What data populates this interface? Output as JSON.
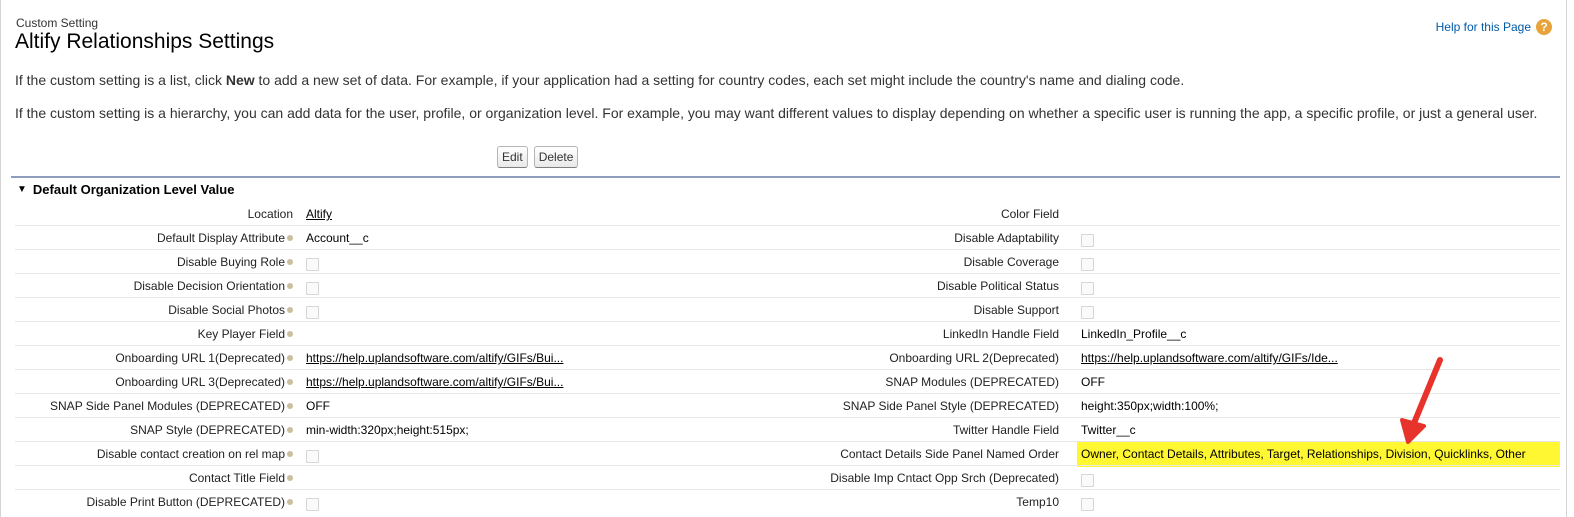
{
  "page": {
    "breadcrumb": "Custom Setting",
    "title": "Altify Relationships Settings",
    "help_link": "Help for this Page",
    "help_icon": "question-mark-icon",
    "para1_prefix": "If the custom setting is a list, click ",
    "para1_bold": "New",
    "para1_suffix": " to add a new set of data. For example, if your application had a setting for country codes, each set might include the country's name and dialing code.",
    "para2": "If the custom setting is a hierarchy, you can add data for the user, profile, or organization level. For example, you may want different values to display depending on whether a specific user is running the app, a specific profile, or just a general user."
  },
  "toolbar": {
    "edit_label": "Edit",
    "delete_label": "Delete"
  },
  "section": {
    "title": "Default Organization Level Value"
  },
  "rows": [
    {
      "l_label": "Location",
      "l_tip": false,
      "l_type": "link",
      "l_value": "Altify",
      "r_label": "Color Field",
      "r_tip": true,
      "r_type": "text",
      "r_value": ""
    },
    {
      "l_label": "Default Display Attribute",
      "l_tip": true,
      "l_type": "text",
      "l_value": "Account__c",
      "r_label": "Disable Adaptability",
      "r_tip": true,
      "r_type": "checkbox",
      "r_value": ""
    },
    {
      "l_label": "Disable Buying Role",
      "l_tip": true,
      "l_type": "checkbox",
      "l_value": "",
      "r_label": "Disable Coverage",
      "r_tip": true,
      "r_type": "checkbox",
      "r_value": ""
    },
    {
      "l_label": "Disable Decision Orientation",
      "l_tip": true,
      "l_type": "checkbox",
      "l_value": "",
      "r_label": "Disable Political Status",
      "r_tip": true,
      "r_type": "checkbox",
      "r_value": ""
    },
    {
      "l_label": "Disable Social Photos",
      "l_tip": true,
      "l_type": "checkbox",
      "l_value": "",
      "r_label": "Disable Support",
      "r_tip": true,
      "r_type": "checkbox",
      "r_value": ""
    },
    {
      "l_label": "Key Player Field",
      "l_tip": true,
      "l_type": "text",
      "l_value": "",
      "r_label": "LinkedIn Handle Field",
      "r_tip": true,
      "r_type": "text",
      "r_value": "LinkedIn_Profile__c"
    },
    {
      "l_label": "Onboarding URL 1(Deprecated)",
      "l_tip": true,
      "l_type": "link",
      "l_value": "https://help.uplandsoftware.com/altify/GIFs/Bui...",
      "r_label": "Onboarding URL 2(Deprecated)",
      "r_tip": true,
      "r_type": "link",
      "r_value": "https://help.uplandsoftware.com/altify/GIFs/Ide..."
    },
    {
      "l_label": "Onboarding URL 3(Deprecated)",
      "l_tip": true,
      "l_type": "link",
      "l_value": "https://help.uplandsoftware.com/altify/GIFs/Bui...",
      "r_label": "SNAP Modules (DEPRECATED)",
      "r_tip": true,
      "r_type": "text",
      "r_value": "OFF"
    },
    {
      "l_label": "SNAP Side Panel Modules (DEPRECATED)",
      "l_tip": true,
      "l_type": "text",
      "l_value": "OFF",
      "r_label": "SNAP Side Panel Style (DEPRECATED)",
      "r_tip": true,
      "r_type": "text",
      "r_value": "height:350px;width:100%;"
    },
    {
      "l_label": "SNAP Style (DEPRECATED)",
      "l_tip": true,
      "l_type": "text",
      "l_value": "min-width:320px;height:515px;",
      "r_label": "Twitter Handle Field",
      "r_tip": true,
      "r_type": "text",
      "r_value": "Twitter__c"
    },
    {
      "l_label": "Disable contact creation on rel map",
      "l_tip": true,
      "l_type": "checkbox",
      "l_value": "",
      "r_label": "Contact Details Side Panel Named Order",
      "r_tip": true,
      "r_type": "text",
      "r_value": "Owner, Contact Details, Attributes, Target, Relationships, Division, Quicklinks, Other"
    },
    {
      "l_label": "Contact Title Field",
      "l_tip": true,
      "l_type": "text",
      "l_value": "",
      "r_label": "Disable Imp Cntact Opp Srch (Deprecated)",
      "r_tip": true,
      "r_type": "checkbox",
      "r_value": ""
    },
    {
      "l_label": "Disable Print Button (DEPRECATED)",
      "l_tip": true,
      "l_type": "checkbox",
      "l_value": "",
      "r_label": "Temp10",
      "r_tip": true,
      "r_type": "checkbox",
      "r_value": ""
    }
  ],
  "annotation": {
    "highlight_color": "#fef731",
    "arrow_color": "#e8322c"
  }
}
